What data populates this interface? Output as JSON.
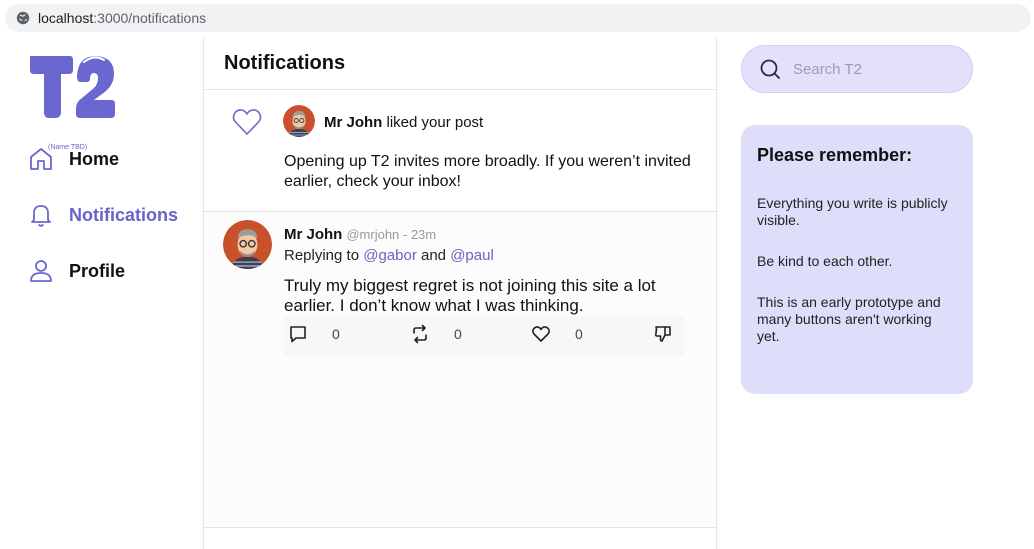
{
  "browser": {
    "url_host": "localhost",
    "url_path": ":3000/notifications"
  },
  "sidebar": {
    "logo_text": "T2",
    "logo_subtitle": "(Name TBD)",
    "items": [
      {
        "label": "Home",
        "icon": "home-icon",
        "active": false
      },
      {
        "label": "Notifications",
        "icon": "bell-icon",
        "active": true
      },
      {
        "label": "Profile",
        "icon": "user-icon",
        "active": false
      }
    ]
  },
  "main": {
    "title": "Notifications",
    "notification": {
      "icon": "heart-icon",
      "user": "Mr John",
      "action": " liked your post",
      "body": "Opening up T2 invites more broadly. If you weren’t invited earlier, check your inbox!"
    },
    "post": {
      "author": "Mr John",
      "meta": "@mrjohn - 23m",
      "reply_prefix": "Replying to ",
      "mention1": "@gabor",
      "reply_and": " and ",
      "mention2": "@paul",
      "text": "Truly my biggest regret is not joining this site a lot earlier. I don’t know what I was thinking.",
      "actions": {
        "reply_count": "0",
        "repost_count": "0",
        "like_count": "0"
      }
    }
  },
  "right": {
    "search_placeholder": "Search T2",
    "remember": {
      "title": "Please remember:",
      "items": [
        "Everything you write is publicly visible.",
        "Be kind to each other.",
        "This is an early prototype and many buttons aren't working yet."
      ]
    }
  },
  "colors": {
    "accent": "#6663c9",
    "panel": "#dfdefa",
    "avatar_bg": "#c8502a"
  }
}
